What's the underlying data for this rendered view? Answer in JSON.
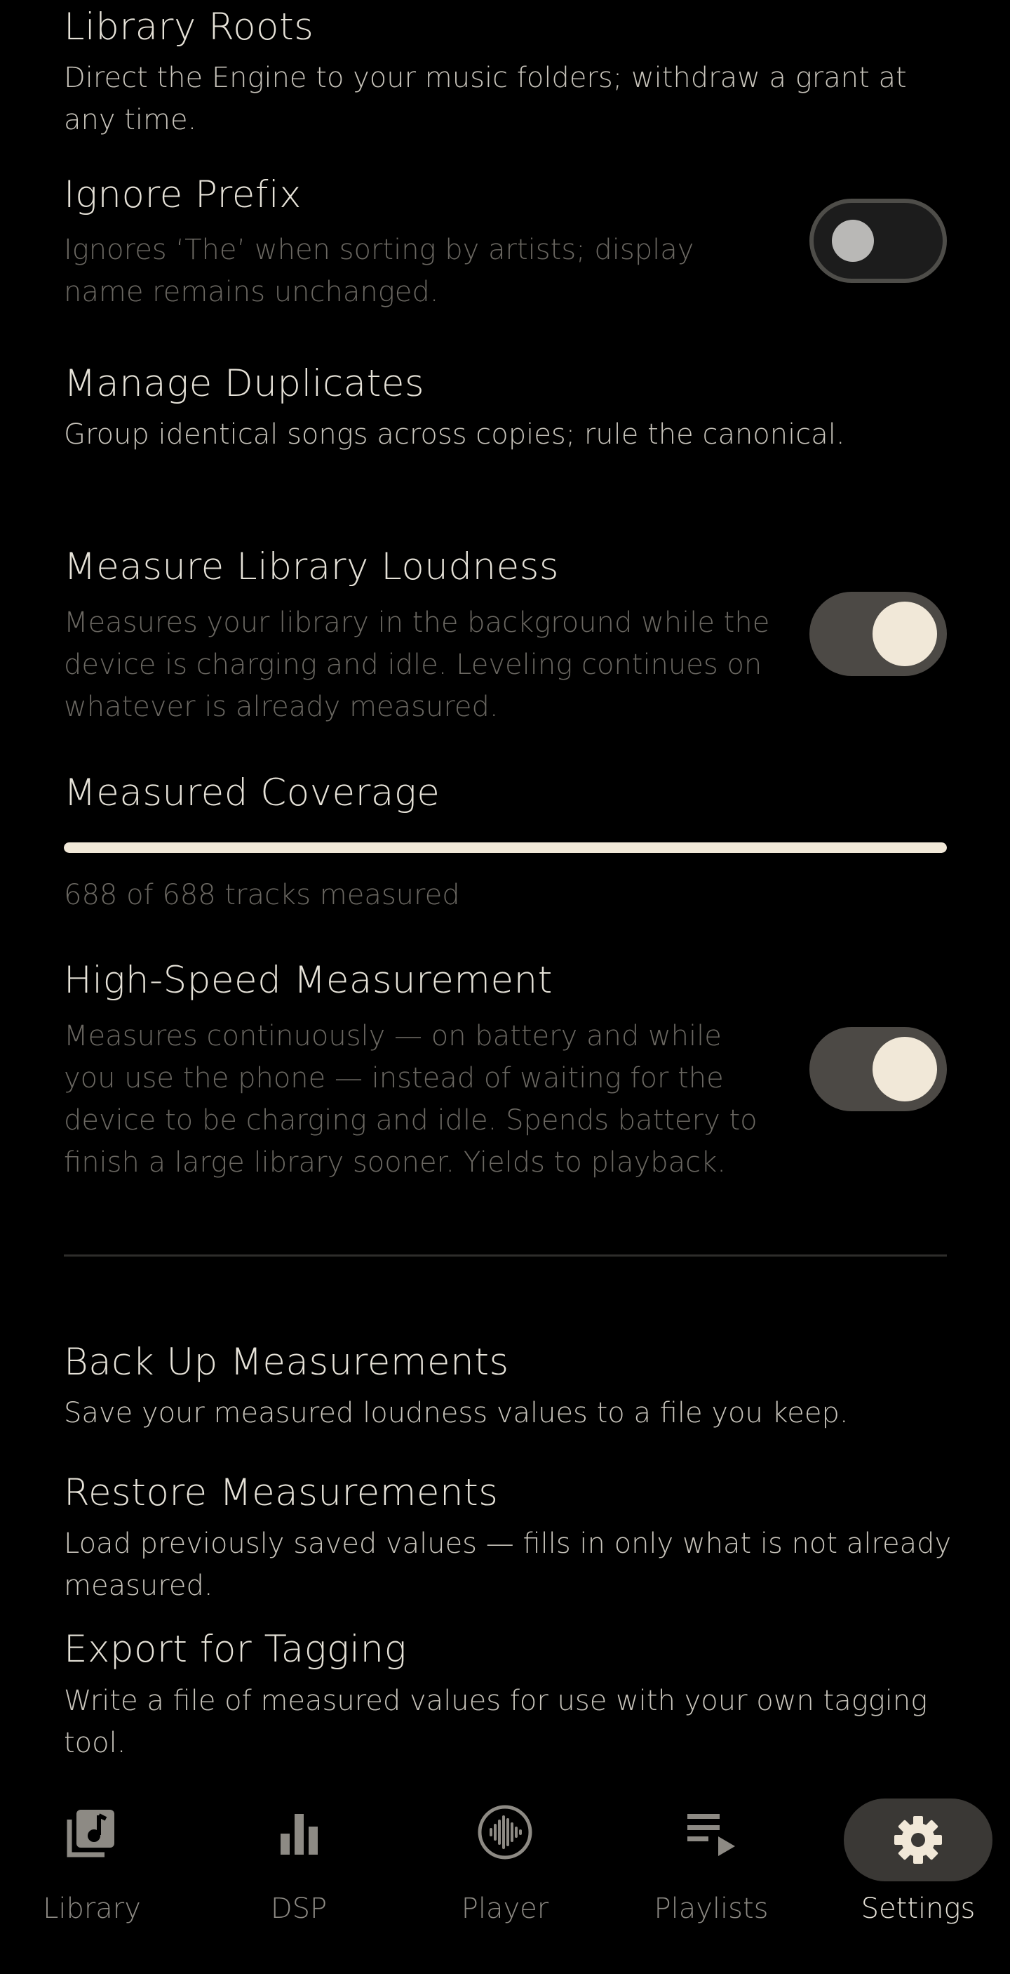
{
  "settings": {
    "library_roots": {
      "title": "Library Roots",
      "description": "Direct the Engine to your music folders; withdraw a grant at any time."
    },
    "ignore_prefix": {
      "title": "Ignore Prefix",
      "description": "Ignores ‘The’ when sorting by artists; display name remains unchanged.",
      "enabled": false
    },
    "manage_duplicates": {
      "title": "Manage Duplicates",
      "description": "Group identical songs across copies; rule the canonical."
    },
    "measure_loudness": {
      "title": "Measure Library Loudness",
      "description": "Measures your library in the background while the device is charging and idle. Leveling continues on whatever is already measured.",
      "enabled": true
    },
    "coverage": {
      "title": "Measured Coverage",
      "status": "688 of 688 tracks measured",
      "progress": 1.0
    },
    "high_speed": {
      "title": "High-Speed Measurement",
      "description": "Measures continuously — on battery and while you use the phone — instead of waiting for the device to be charging and idle. Spends battery to finish a large library sooner. Yields to playback.",
      "enabled": true
    },
    "backup": {
      "title": "Back Up Measurements",
      "description": "Save your measured loudness values to a file you keep."
    },
    "restore": {
      "title": "Restore Measurements",
      "description": "Load previously saved values — fills in only what is not already measured."
    },
    "export": {
      "title": "Export for Tagging",
      "description": "Write a file of measured values for use with your own tagging tool."
    }
  },
  "nav": {
    "items": [
      {
        "label": "Library",
        "icon": "library-icon"
      },
      {
        "label": "DSP",
        "icon": "equalizer-icon"
      },
      {
        "label": "Player",
        "icon": "waveform-icon"
      },
      {
        "label": "Playlists",
        "icon": "playlist-icon"
      },
      {
        "label": "Settings",
        "icon": "gear-icon",
        "active": true
      }
    ]
  },
  "colors": {
    "accent": "#f1e8d8",
    "background": "#000000",
    "text_primary": "#e6e2d8",
    "text_secondary": "#c9c5bc",
    "text_dim": "#6b6862"
  }
}
